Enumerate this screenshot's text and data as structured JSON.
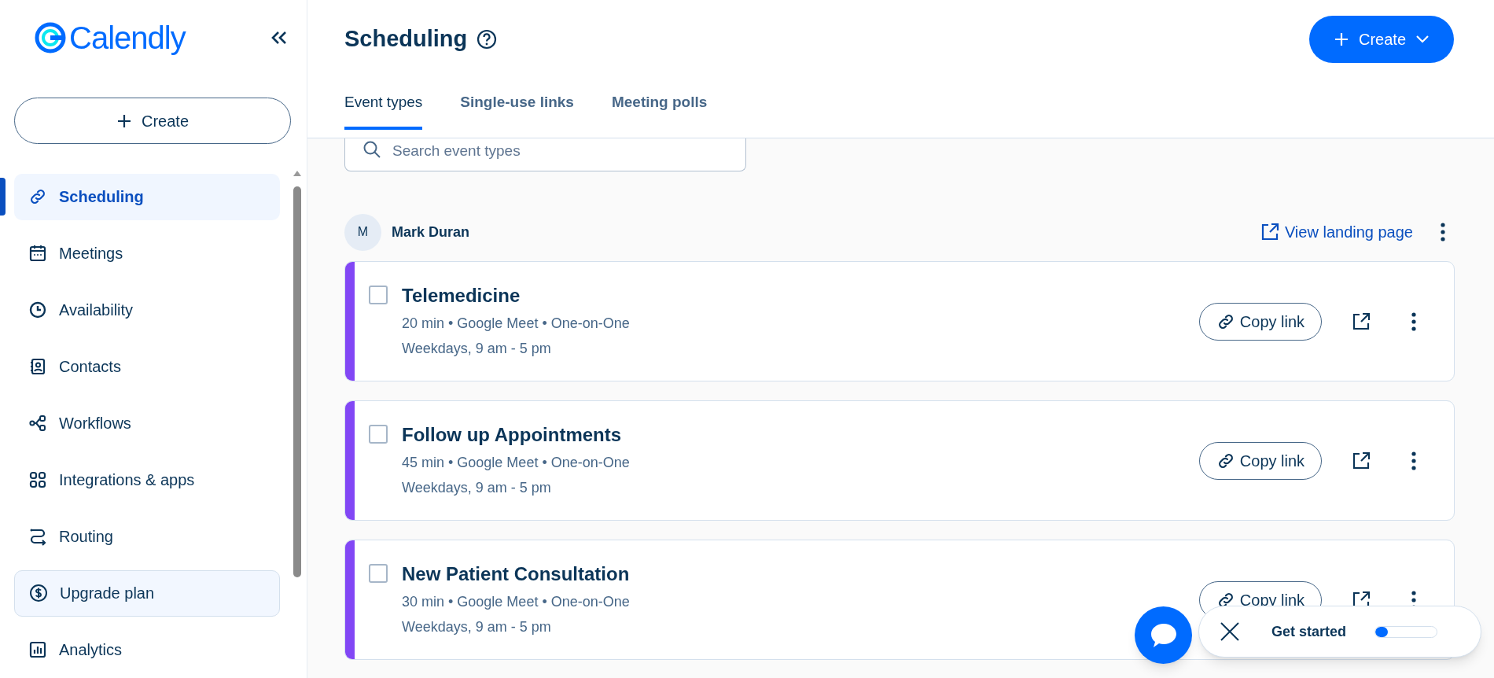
{
  "sidebar": {
    "logo": "Calendly",
    "create_button": "Create",
    "items": [
      {
        "label": "Scheduling",
        "kind": "nav",
        "selected": true
      },
      {
        "label": "Meetings",
        "kind": "nav",
        "selected": false
      },
      {
        "label": "Availability",
        "kind": "nav",
        "selected": false
      },
      {
        "label": "Contacts",
        "kind": "nav",
        "selected": false
      },
      {
        "label": "Workflows",
        "kind": "nav",
        "selected": false
      },
      {
        "label": "Integrations & apps",
        "kind": "nav",
        "selected": false
      },
      {
        "label": "Routing",
        "kind": "nav",
        "selected": false
      },
      {
        "label": "Upgrade plan",
        "kind": "upgrade",
        "selected": false
      },
      {
        "label": "Analytics",
        "kind": "nav",
        "selected": false
      }
    ]
  },
  "header": {
    "title": "Scheduling",
    "create_button": "Create",
    "tabs": [
      {
        "label": "Event types",
        "selected": true
      },
      {
        "label": "Single-use links",
        "selected": false
      },
      {
        "label": "Meeting polls",
        "selected": false
      }
    ]
  },
  "search": {
    "placeholder": "Search event types"
  },
  "user": {
    "initial": "M",
    "name": "Mark Duran",
    "landing_link": "View landing page"
  },
  "event_types": [
    {
      "title": "Telemedicine",
      "meta": "20 min • Google Meet • One-on-One",
      "hours": "Weekdays, 9 am - 5 pm",
      "color": "#8247f5",
      "checked": false,
      "copy_button": "Copy link"
    },
    {
      "title": "Follow up Appointments",
      "meta": "45 min • Google Meet • One-on-One",
      "hours": "Weekdays, 9 am - 5 pm",
      "color": "#8247f5",
      "checked": false,
      "copy_button": "Copy link"
    },
    {
      "title": "New Patient Consultation",
      "meta": "30 min • Google Meet • One-on-One",
      "hours": "Weekdays, 9 am - 5 pm",
      "color": "#8247f5",
      "checked": false,
      "copy_button": "Copy link"
    }
  ],
  "get_started": {
    "label": "Get started",
    "level": 0.2
  }
}
